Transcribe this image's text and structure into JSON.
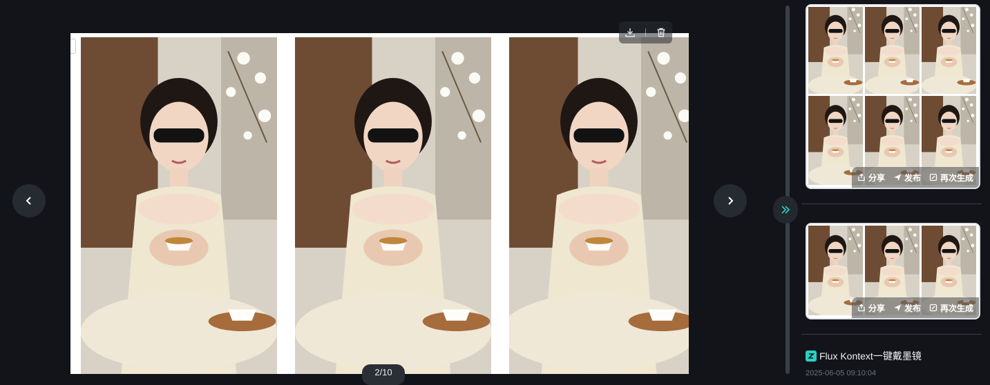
{
  "viewer": {
    "images": [
      {
        "name": "woman-sunglasses-tea-1"
      },
      {
        "name": "woman-sunglasses-tea-2"
      },
      {
        "name": "woman-sunglasses-tea-3"
      }
    ],
    "toolbar": {
      "download_icon": "download-icon",
      "delete_icon": "trash-icon"
    },
    "prev_icon": "chevron-left-icon",
    "next_icon": "chevron-right-icon",
    "page_indicator": "2/10"
  },
  "sidebar": {
    "collapse_icon": "double-chevron-right-icon",
    "cards": [
      {
        "thumb_count": 6,
        "actions": [
          {
            "label": "分享",
            "icon": "share-icon"
          },
          {
            "label": "发布",
            "icon": "send-icon"
          },
          {
            "label": "再次生成",
            "icon": "regenerate-icon"
          }
        ]
      },
      {
        "thumb_count": 3,
        "actions": [
          {
            "label": "分享",
            "icon": "share-icon"
          },
          {
            "label": "发布",
            "icon": "send-icon"
          },
          {
            "label": "再次生成",
            "icon": "regenerate-icon"
          }
        ]
      }
    ],
    "model_title": "Flux Kontext一键戴墨镜",
    "timestamp": "2025-06-05 09:10:04"
  },
  "colors": {
    "background": "#121419",
    "accent": "#2ad1c4",
    "card_border": "#dfe3e8"
  }
}
